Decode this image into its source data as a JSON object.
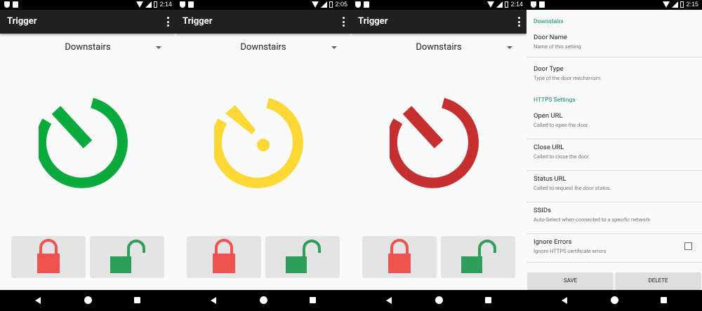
{
  "screens": [
    {
      "time": "2:14",
      "app_title": "Trigger",
      "door_selected": "Downstairs",
      "state": "open",
      "state_color": "#0aaa3c"
    },
    {
      "time": "2:05",
      "app_title": "Trigger",
      "door_selected": "Downstairs",
      "state": "unknown",
      "state_color": "#fdd835"
    },
    {
      "time": "2:14",
      "app_title": "Trigger",
      "door_selected": "Downstairs",
      "state": "closed",
      "state_color": "#c62f30"
    }
  ],
  "settings_screen": {
    "time": "2:15",
    "category_door": "Downstairs",
    "category_https": "HTTPS Settings",
    "prefs": [
      {
        "title": "Door Name",
        "summary": "Name of this setting"
      },
      {
        "title": "Door Type",
        "summary": "Type of the door mechanism."
      },
      {
        "title": "Open URL",
        "summary": "Called to open the door."
      },
      {
        "title": "Close URL",
        "summary": "Called to close the door."
      },
      {
        "title": "Status URL",
        "summary": "Called to request the door status."
      },
      {
        "title": "SSIDs",
        "summary": "Auto-Select when connected to a specific network"
      },
      {
        "title": "Ignore Errors",
        "summary": "Ignore HTTPS certificate errors",
        "checked": false
      }
    ],
    "save_label": "SAVE",
    "delete_label": "DELETE"
  },
  "icons": {
    "lock_button": "lock-closed-icon",
    "unlock_button": "lock-open-icon",
    "overflow_menu": "more-vert-icon",
    "nav_back": "back-triangle-icon",
    "nav_home": "home-circle-icon",
    "nav_recents": "recents-square-icon"
  },
  "colors": {
    "appbar": "#212121",
    "lock_red": "#ef5350",
    "unlock_green": "#2e9e5b",
    "accent_teal": "#00897b"
  }
}
